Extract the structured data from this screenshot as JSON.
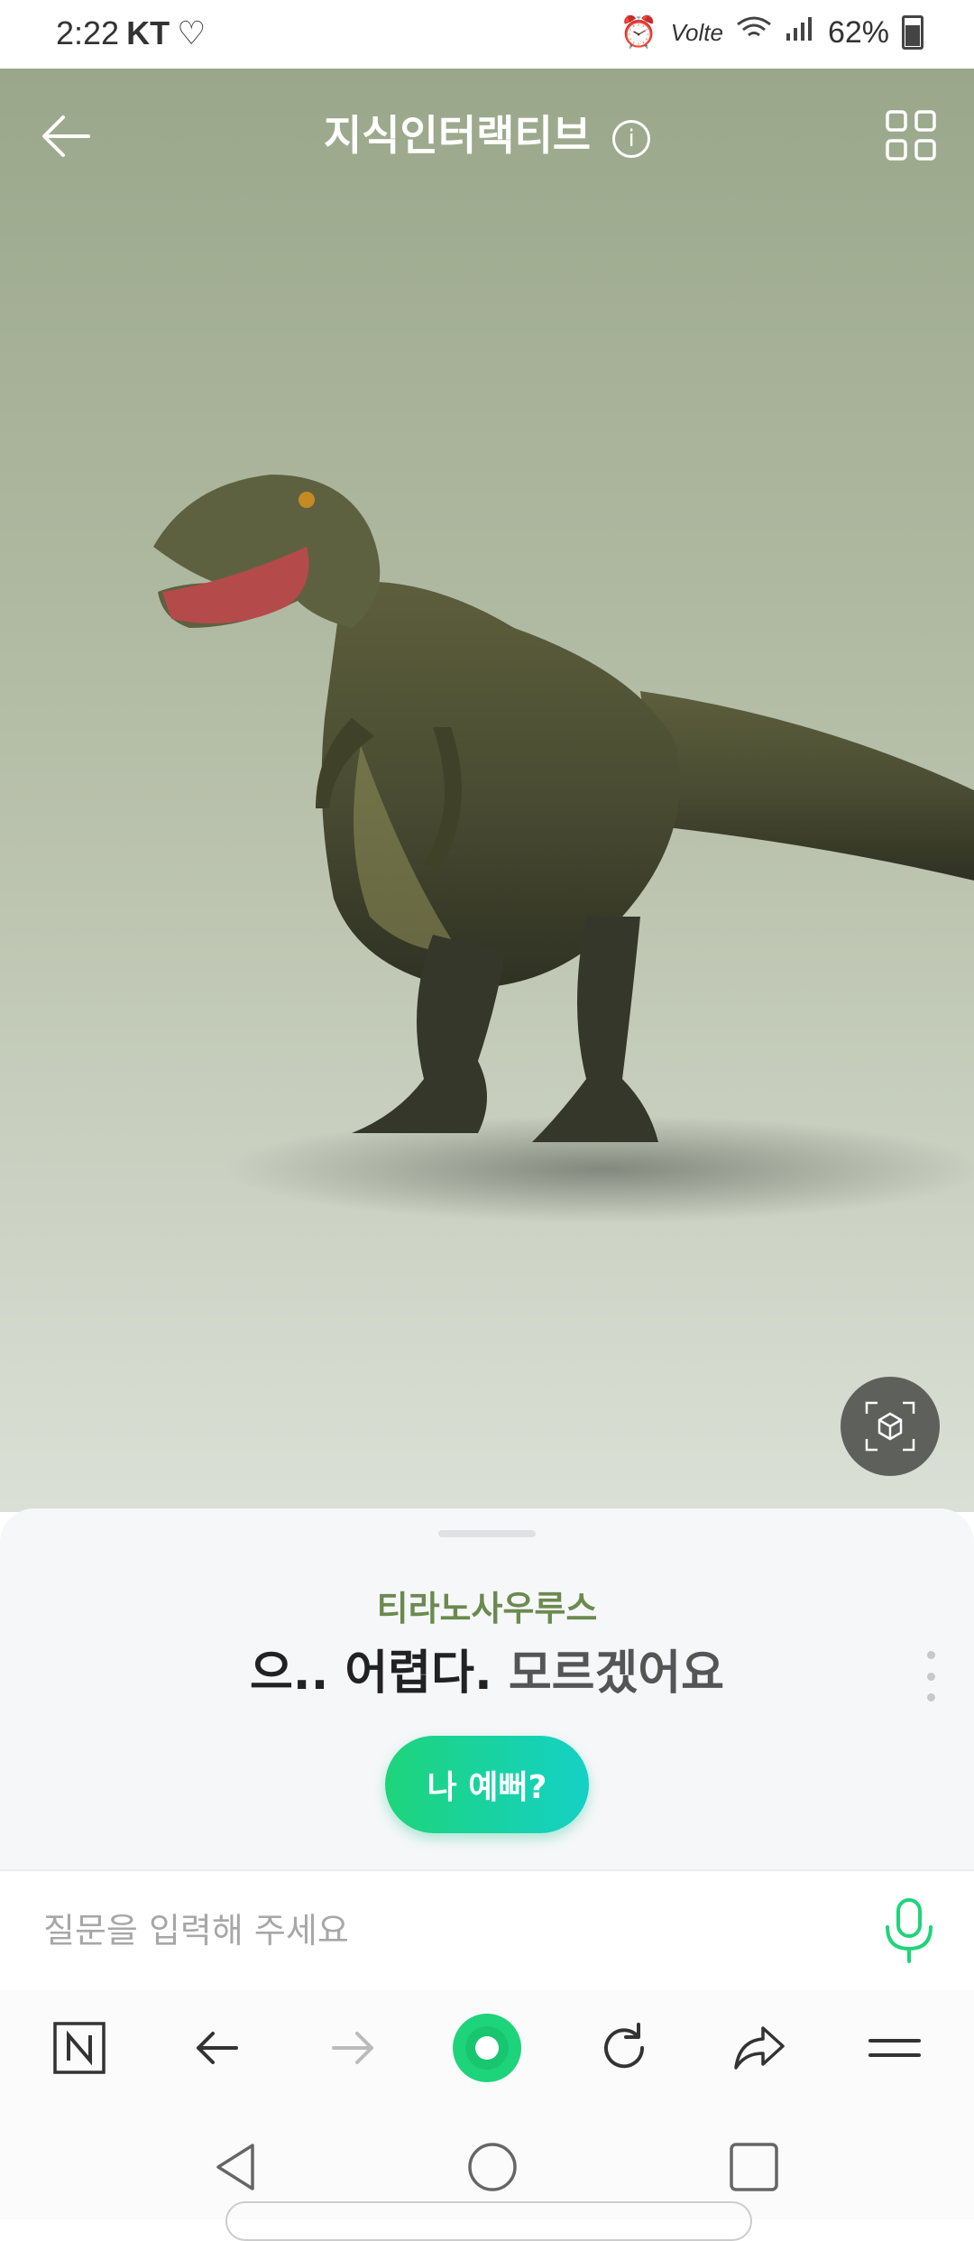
{
  "status_bar": {
    "time": "2:22",
    "carrier": "KT",
    "network": "Volte",
    "battery": "62%"
  },
  "header": {
    "title": "지식인터랙티브",
    "info_glyph": "i"
  },
  "sheet": {
    "dino_name": "티라노사우루스",
    "speech_part1": "으.. 어렵다.",
    "speech_part2": "모르겠어요",
    "suggestion": "나 예뻐?"
  },
  "input": {
    "placeholder": "질문을 입력해 주세요"
  },
  "colors": {
    "accent": "#1ed47a",
    "name_green": "#6b8a4f",
    "bg_top": "#9aa78a"
  },
  "icons": [
    "back-arrow-icon",
    "info-icon",
    "grid-icon",
    "ar-cube-icon",
    "more-vertical-icon",
    "mic-icon",
    "naver-n-icon",
    "browser-back-icon",
    "browser-forward-icon",
    "home-circle-icon",
    "refresh-icon",
    "share-icon",
    "menu-icon",
    "nav-back-icon",
    "nav-home-icon",
    "nav-recent-icon"
  ]
}
